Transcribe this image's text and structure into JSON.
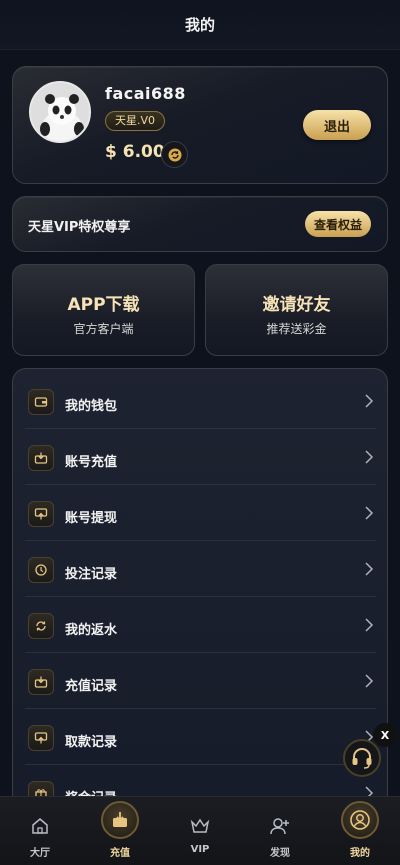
{
  "header": {
    "title": "我的"
  },
  "profile": {
    "username": "facai688",
    "level": "天星.V0",
    "balance": "$ 6.00",
    "logout_label": "退出"
  },
  "vip": {
    "text": "天星VIP特权尊享",
    "button": "查看权益"
  },
  "promos": [
    {
      "title": "APP下载",
      "subtitle": "官方客户端"
    },
    {
      "title": "邀请好友",
      "subtitle": "推荐送彩金"
    }
  ],
  "menu": [
    {
      "label": "我的钱包",
      "icon": "wallet-icon"
    },
    {
      "label": "账号充值",
      "icon": "deposit-icon"
    },
    {
      "label": "账号提现",
      "icon": "withdraw-icon"
    },
    {
      "label": "投注记录",
      "icon": "bet-record-icon"
    },
    {
      "label": "我的返水",
      "icon": "rebate-icon"
    },
    {
      "label": "充值记录",
      "icon": "deposit-record-icon"
    },
    {
      "label": "取款记录",
      "icon": "withdraw-record-icon"
    },
    {
      "label": "奖金记录",
      "icon": "bonus-record-icon"
    }
  ],
  "floating": {
    "close_label": "X"
  },
  "tabs": [
    {
      "label": "大厅",
      "icon": "home-icon"
    },
    {
      "label": "充值",
      "icon": "deposit-tab-icon"
    },
    {
      "label": "VIP",
      "icon": "crown-icon"
    },
    {
      "label": "发现",
      "icon": "add-friend-icon"
    },
    {
      "label": "我的",
      "icon": "user-icon"
    }
  ],
  "colors": {
    "accent_gold": "#f1d9a0",
    "background": "#0e121c"
  }
}
